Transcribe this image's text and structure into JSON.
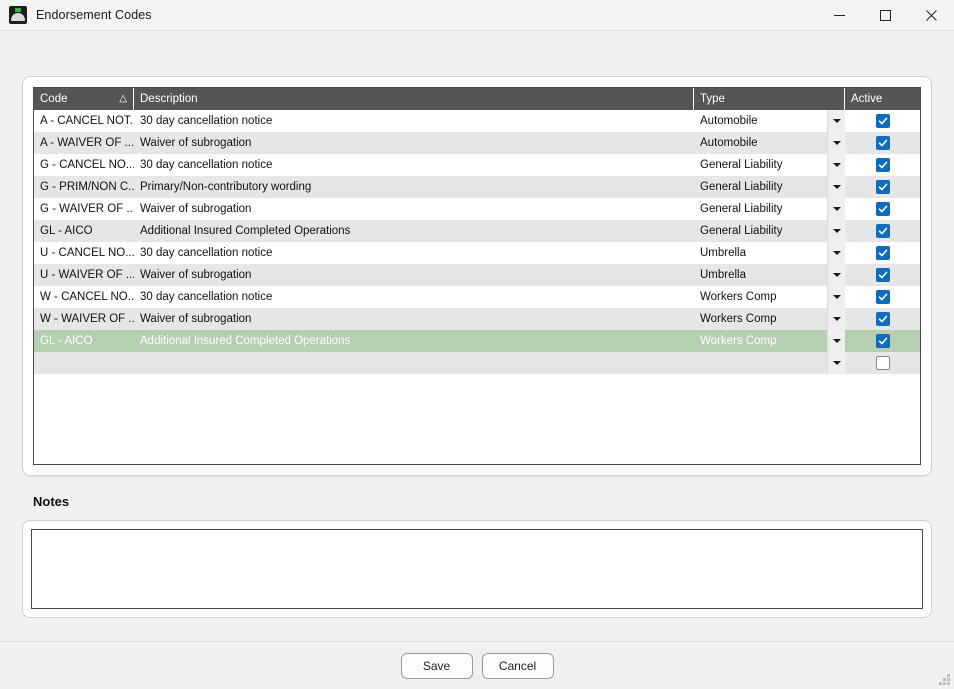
{
  "window": {
    "title": "Endorsement Codes",
    "icon": "app-icon",
    "minimize_label": "Minimize",
    "maximize_label": "Maximize",
    "close_label": "Close"
  },
  "grid": {
    "columns": [
      {
        "key": "code",
        "label": "Code",
        "sort": "△"
      },
      {
        "key": "desc",
        "label": "Description",
        "sort": ""
      },
      {
        "key": "type",
        "label": "Type",
        "sort": ""
      },
      {
        "key": "active",
        "label": "Active",
        "sort": ""
      }
    ],
    "rows": [
      {
        "code": "A - CANCEL NOT...",
        "desc": "30 day cancellation notice",
        "type": "Automobile",
        "active": true,
        "selected": false
      },
      {
        "code": "A - WAIVER OF ...",
        "desc": "Waiver of subrogation",
        "type": "Automobile",
        "active": true,
        "selected": false
      },
      {
        "code": "G - CANCEL NO...",
        "desc": "30 day cancellation notice",
        "type": "General Liability",
        "active": true,
        "selected": false
      },
      {
        "code": "G - PRIM/NON C...",
        "desc": "Primary/Non-contributory wording",
        "type": "General Liability",
        "active": true,
        "selected": false
      },
      {
        "code": "G - WAIVER OF ...",
        "desc": "Waiver of subrogation",
        "type": "General Liability",
        "active": true,
        "selected": false
      },
      {
        "code": "GL - AICO",
        "desc": "Additional Insured Completed Operations",
        "type": "General Liability",
        "active": true,
        "selected": false
      },
      {
        "code": "U - CANCEL NO...",
        "desc": "30 day cancellation notice",
        "type": "Umbrella",
        "active": true,
        "selected": false
      },
      {
        "code": "U - WAIVER OF ...",
        "desc": "Waiver of subrogation",
        "type": "Umbrella",
        "active": true,
        "selected": false
      },
      {
        "code": "W - CANCEL NO...",
        "desc": "30 day cancellation notice",
        "type": "Workers Comp",
        "active": true,
        "selected": false
      },
      {
        "code": "W - WAIVER OF ...",
        "desc": "Waiver of subrogation",
        "type": "Workers Comp",
        "active": true,
        "selected": false
      },
      {
        "code": "GL - AICO",
        "desc": "Additional Insured Completed Operations",
        "type": "Workers Comp",
        "active": true,
        "selected": true
      },
      {
        "code": "",
        "desc": "",
        "type": "",
        "active": false,
        "selected": false
      }
    ]
  },
  "notes": {
    "label": "Notes",
    "value": "",
    "placeholder": ""
  },
  "footer": {
    "save_label": "Save",
    "cancel_label": "Cancel"
  },
  "colors": {
    "header_bg": "#555555",
    "row_alt_bg": "#e6e6e6",
    "selected_row_bg": "#b6ceb1",
    "checkbox_blue": "#0f6cbd",
    "window_bg": "#f0f0f0"
  }
}
